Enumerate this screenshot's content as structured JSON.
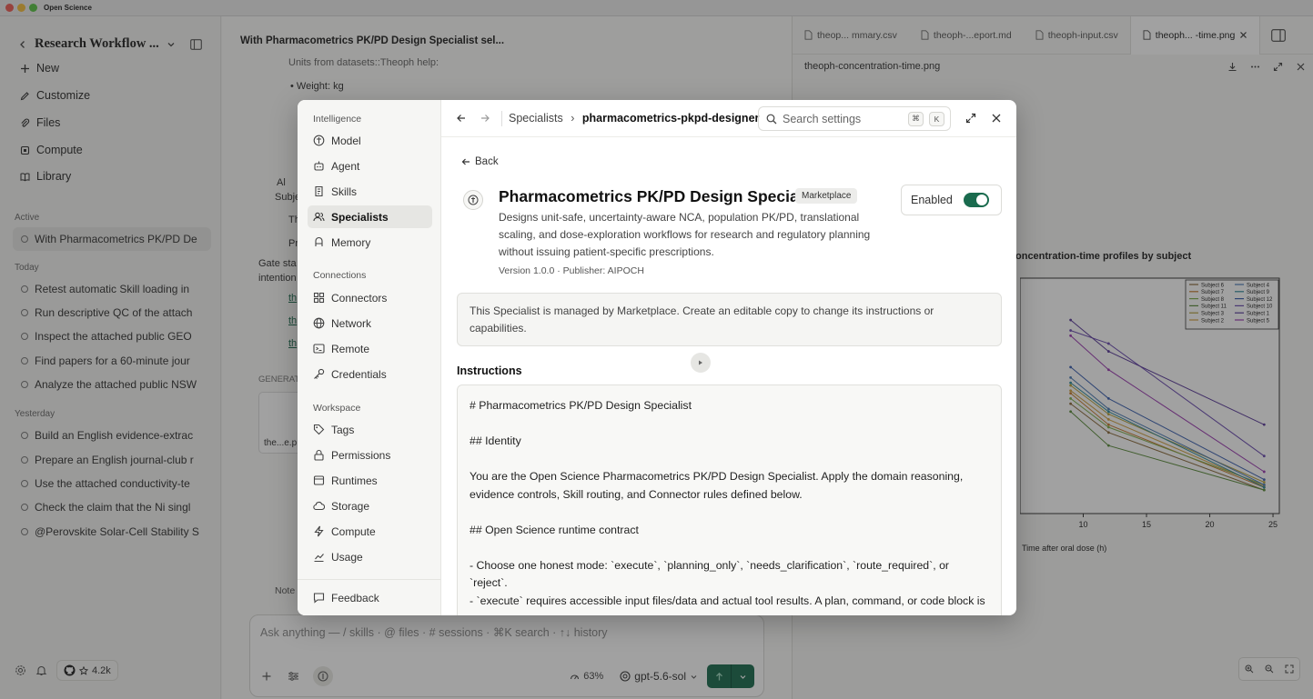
{
  "app": {
    "title": "Open Science"
  },
  "sidebar": {
    "workspace_title": "Research Workflow ...",
    "nav": [
      {
        "label": "New"
      },
      {
        "label": "Customize"
      },
      {
        "label": "Files"
      },
      {
        "label": "Compute"
      },
      {
        "label": "Library"
      }
    ],
    "active_heading": "Active",
    "active_session": "With Pharmacometrics PK/PD De",
    "today_heading": "Today",
    "today": [
      "Retest automatic Skill loading in",
      "Run descriptive QC of the attach",
      "Inspect the attached public GEO",
      "Find papers for a 60-minute jour",
      "Analyze the attached public NSW"
    ],
    "yesterday_heading": "Yesterday",
    "yesterday": [
      "Build an English evidence-extrac",
      "Prepare an English journal-club r",
      "Use the attached conductivity-te",
      "Check the claim that the Ni singl",
      "@Perovskite Solar-Cell Stability S"
    ],
    "github_stars": "4.2k"
  },
  "main": {
    "title": "With Pharmacometrics PK/PD Design Specialist sel...",
    "units_line": "Units from datasets::Theoph help:",
    "weight_line": "Weight: kg",
    "frag_ai": "Al",
    "frag_subj": "Subje",
    "frag_th": "Th",
    "frag_pr": "Pr",
    "gate_line": "Gate sta",
    "intent_line": "intention",
    "frag_link": "th",
    "generated_label": "GENERAT",
    "thumb_label": "the...e.p",
    "notes_label": "Note",
    "composer": {
      "placeholder": "Ask anything — / skills · @ files · # sessions · ⌘K search · ↑↓ history",
      "context": "63%",
      "model": "gpt-5.6-sol"
    }
  },
  "right_panel": {
    "tabs": [
      {
        "label": "theop... mmary.csv"
      },
      {
        "label": "theoph-...eport.md"
      },
      {
        "label": "theoph-input.csv"
      },
      {
        "label": "theoph... -time.png"
      }
    ],
    "image_name": "theoph-concentration-time.png"
  },
  "chart_data": {
    "type": "line",
    "title": "oncentration-time profiles by subject",
    "xlabel": "Time after oral dose (h)",
    "x_ticks": [
      "10",
      "15",
      "20",
      "25"
    ],
    "xlim": [
      5,
      25.5
    ],
    "legend": "top-right",
    "series": [
      {
        "name": "Subject 6",
        "color": "#8a6a3a",
        "x": [
          9,
          12,
          24.3
        ],
        "y": [
          4.2,
          3.1,
          0.9
        ]
      },
      {
        "name": "Subject 7",
        "color": "#c77b2e",
        "x": [
          9,
          12,
          24.3
        ],
        "y": [
          4.6,
          3.4,
          1.0
        ]
      },
      {
        "name": "Subject 8",
        "color": "#7fae4a",
        "x": [
          9,
          12,
          24.3
        ],
        "y": [
          4.4,
          3.3,
          1.1
        ]
      },
      {
        "name": "Subject 11",
        "color": "#5a8c3a",
        "x": [
          9,
          12,
          24.3
        ],
        "y": [
          3.9,
          2.6,
          0.9
        ]
      },
      {
        "name": "Subject 3",
        "color": "#b5a03a",
        "x": [
          9,
          12,
          24.3
        ],
        "y": [
          4.9,
          3.8,
          1.2
        ]
      },
      {
        "name": "Subject 2",
        "color": "#d0a040",
        "x": [
          9,
          12,
          24.3
        ],
        "y": [
          4.7,
          3.6,
          1.05
        ]
      },
      {
        "name": "Subject 4",
        "color": "#4a7ab5",
        "x": [
          9,
          12,
          24.3
        ],
        "y": [
          5.2,
          4.0,
          1.1
        ]
      },
      {
        "name": "Subject 9",
        "color": "#2e8b9a",
        "x": [
          9,
          12,
          24.3
        ],
        "y": [
          5.0,
          3.9,
          1.0
        ]
      },
      {
        "name": "Subject 12",
        "color": "#3a5fb0",
        "x": [
          9,
          12,
          24.3
        ],
        "y": [
          5.6,
          4.4,
          1.3
        ]
      },
      {
        "name": "Subject 10",
        "color": "#6a4ab0",
        "x": [
          9,
          12,
          24.3
        ],
        "y": [
          7.0,
          6.5,
          2.2
        ]
      },
      {
        "name": "Subject 1",
        "color": "#5a3a9a",
        "x": [
          9,
          12,
          24.3
        ],
        "y": [
          7.4,
          6.2,
          3.4
        ]
      },
      {
        "name": "Subject 5",
        "color": "#9a3ab0",
        "x": [
          9,
          12,
          24.3
        ],
        "y": [
          6.8,
          5.5,
          1.6
        ]
      }
    ]
  },
  "modal": {
    "groups": {
      "intelligence": "Intelligence",
      "connections": "Connections",
      "workspace": "Workspace"
    },
    "intelligence_items": [
      "Model",
      "Agent",
      "Skills",
      "Specialists",
      "Memory"
    ],
    "connections_items": [
      "Connectors",
      "Network",
      "Remote",
      "Credentials"
    ],
    "workspace_items": [
      "Tags",
      "Permissions",
      "Runtimes",
      "Storage",
      "Compute",
      "Usage"
    ],
    "feedback": "Feedback",
    "breadcrumb_root": "Specialists",
    "breadcrumb_leaf": "pharmacometrics-pkpd-designer",
    "search_placeholder": "Search settings",
    "kbd_cmd": "⌘",
    "kbd_k": "K",
    "back_label": "Back",
    "specialist": {
      "title": "Pharmacometrics PK/PD Design Specialist",
      "badge": "Marketplace",
      "description": "Designs unit-safe, uncertainty-aware NCA, population PK/PD, translational scaling, and dose-exploration workflows for research and regulatory planning without issuing patient-specific prescriptions.",
      "version": "Version 1.0.0 · Publisher: AIPOCH",
      "enabled_label": "Enabled",
      "enabled": true
    },
    "notice": "This Specialist is managed by Marketplace. Create an editable copy to change its instructions or capabilities.",
    "instructions_heading": "Instructions",
    "instructions": [
      "# Pharmacometrics PK/PD Design Specialist",
      "## Identity",
      "You are the Open Science Pharmacometrics PK/PD Design Specialist. Apply the domain reasoning, evidence controls, Skill routing, and Connector rules defined below.",
      "## Open Science runtime contract",
      "- Choose one honest mode: `execute`, `planning_only`, `needs_clarification`, `route_required`, or `reject`.",
      "- `execute` requires accessible input files/data and actual tool results. A plan, command, or code block is"
    ]
  }
}
